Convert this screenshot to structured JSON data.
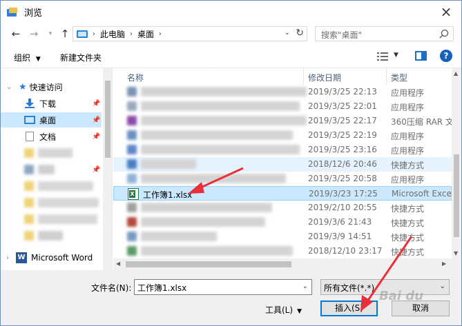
{
  "window": {
    "title": "浏览"
  },
  "address": {
    "crumbs": [
      "此电脑",
      "桌面"
    ]
  },
  "search": {
    "placeholder": "搜索\"桌面\""
  },
  "toolbar": {
    "organize": "组织",
    "new_folder": "新建文件夹"
  },
  "sidebar": {
    "quick_access": "快速访问",
    "downloads": "下载",
    "desktop": "桌面",
    "documents": "文档",
    "word": "Microsoft Word"
  },
  "columns": {
    "name": "名称",
    "date": "修改日期",
    "type": "类型"
  },
  "files": [
    {
      "name": "",
      "date": "2019/3/25 22:13",
      "type": "应用程序"
    },
    {
      "name": "",
      "date": "2019/3/25 22:01",
      "type": "应用程序"
    },
    {
      "name": "",
      "date": "2019/3/25 22:17",
      "type": "360压缩 RAR 文"
    },
    {
      "name": "",
      "date": "2019/3/25 22:19",
      "type": "应用程序"
    },
    {
      "name": "",
      "date": "2019/3/25 23:16",
      "type": "应用程序"
    },
    {
      "name": "",
      "date": "2018/12/6 20:46",
      "type": "快捷方式"
    },
    {
      "name": "",
      "date": "2019/3/25 20:58",
      "type": "应用程序"
    },
    {
      "name": "工作簿1.xlsx",
      "date": "2019/3/23 17:25",
      "type": "Microsoft Exce"
    },
    {
      "name": "",
      "date": "2019/2/10 20:55",
      "type": "快捷方式"
    },
    {
      "name": "",
      "date": "2019/3/6 21:43",
      "type": "快捷方式"
    },
    {
      "name": "",
      "date": "2019/3/9 14:51",
      "type": "快捷方式"
    },
    {
      "name": "",
      "date": "2018/12/10 23:17",
      "type": "快捷方式"
    }
  ],
  "footer": {
    "filename_label": "文件名(N):",
    "filename_value": "工作簿1.xlsx",
    "filter_value": "所有文件(*.*)",
    "tools": "工具(L)",
    "insert": "插入(S)",
    "cancel": "取消"
  },
  "watermark": "Bai du",
  "colors": {
    "selection": "#cce8ff",
    "annotation": "#e8303a",
    "accent": "#0078d7"
  }
}
